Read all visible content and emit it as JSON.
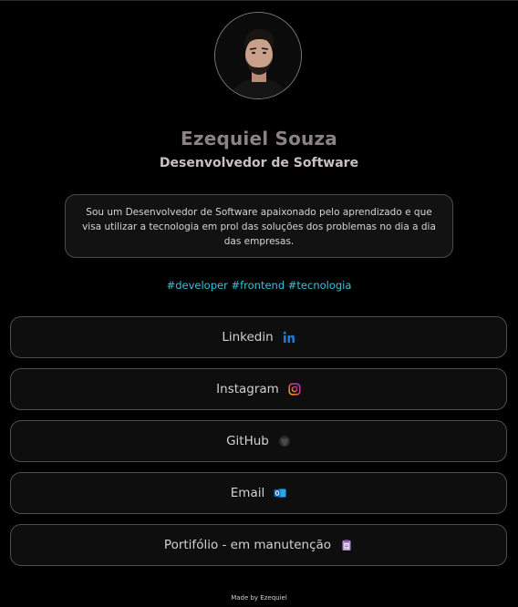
{
  "profile": {
    "name": "Ezequiel Souza",
    "role": "Desenvolvedor de Software",
    "bio": "Sou um Desenvolvedor de Software apaixonado pelo aprendizado e que visa utilizar a tecnologia em prol das soluções dos problemas no dia a dia das empresas.",
    "tags": "#developer #frontend #tecnologia"
  },
  "links": [
    {
      "label": "Linkedin",
      "icon": "linkedin-icon"
    },
    {
      "label": "Instagram",
      "icon": "instagram-icon"
    },
    {
      "label": "GitHub",
      "icon": "github-icon"
    },
    {
      "label": "Email",
      "icon": "outlook-icon"
    },
    {
      "label": "Portifólio - em manutenção",
      "icon": "clipboard-icon"
    }
  ],
  "colors": {
    "accent_tags": "#34c3e0",
    "linkedin": "#0a66c2",
    "outlook": "#0f6cbd"
  },
  "footer": "Made by Ezequiel"
}
